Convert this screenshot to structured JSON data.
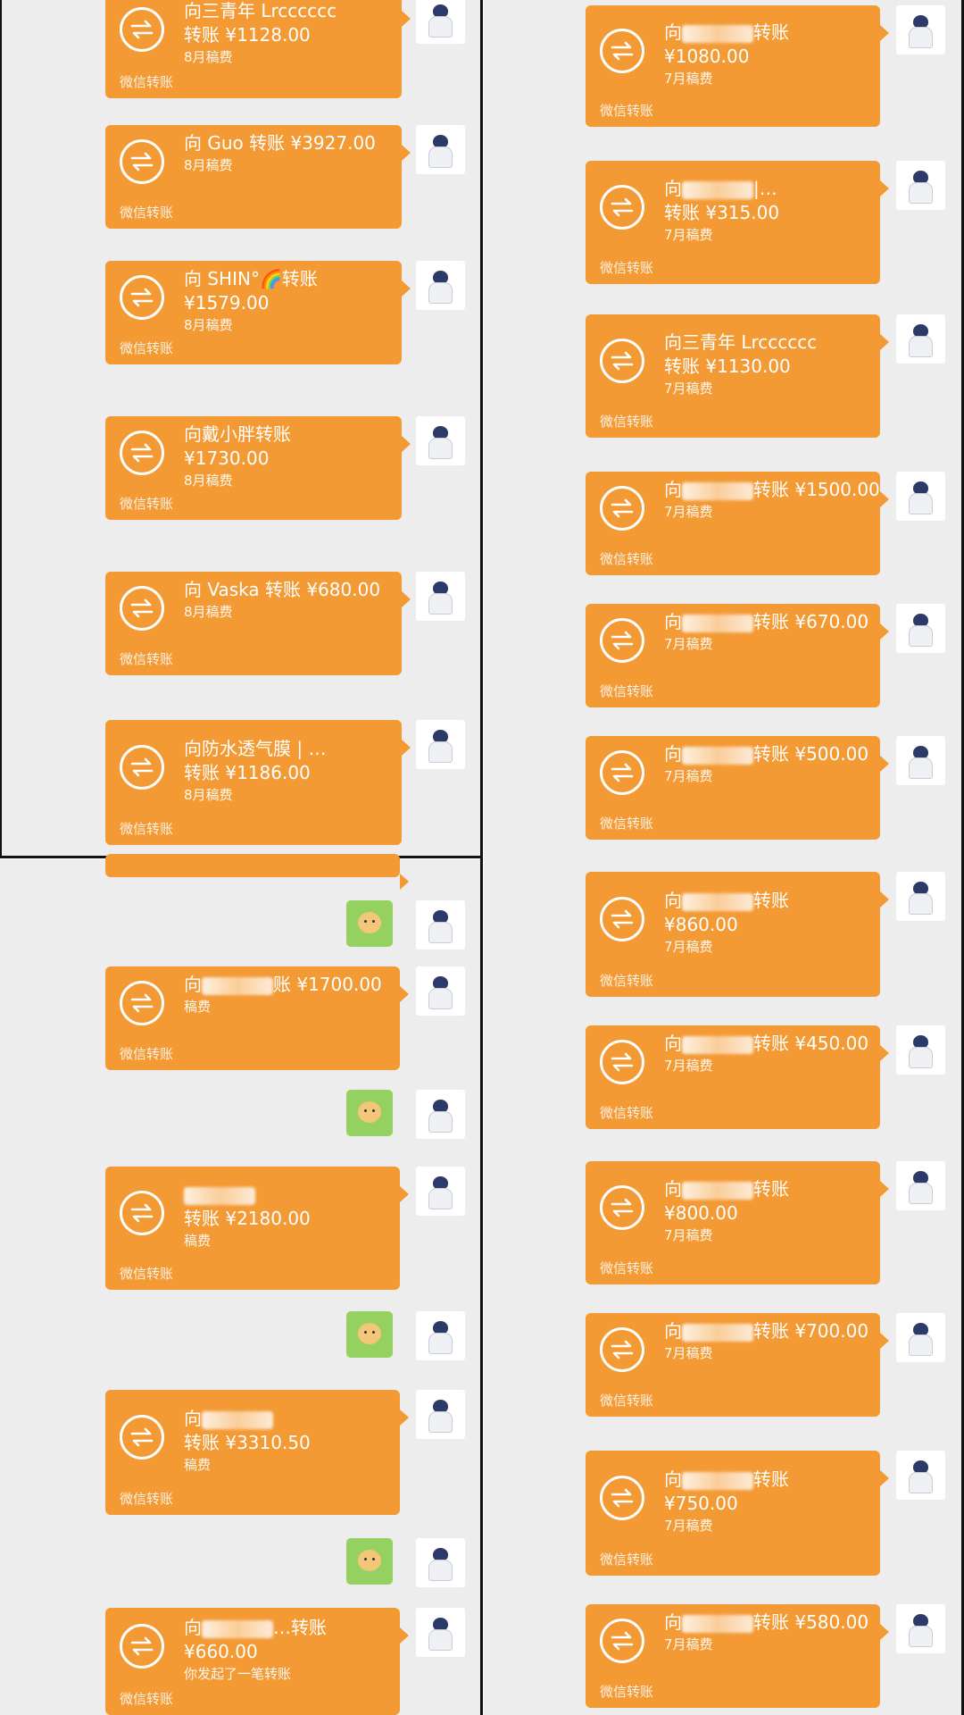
{
  "footer_label": "微信转账",
  "left_top": [
    {
      "line1": "向三青年 Lrcccccc",
      "line2": "转账 ¥1128.00",
      "note": "8月稿费"
    },
    {
      "line1": "向 Guo 转账 ¥3927.00",
      "line2": "",
      "note": "8月稿费"
    },
    {
      "line1": "向 SHIN°🌈转账",
      "line2": "¥1579.00",
      "note": "8月稿费"
    },
    {
      "line1": "向戴小胖转账",
      "line2": "¥1730.00",
      "note": "8月稿费"
    },
    {
      "line1": "向 Vaska 转账 ¥680.00",
      "line2": "",
      "note": "8月稿费"
    },
    {
      "line1": "向防水透气膜 | …",
      "line2": "转账 ¥1186.00",
      "note": "8月稿费"
    }
  ],
  "left_bottom": [
    {
      "line1": "向",
      "blur": true,
      "line1b": "账 ¥1700.00",
      "line2": "",
      "note": "稿费"
    },
    {
      "line1": "",
      "blur": true,
      "line2": "转账 ¥2180.00",
      "note": "稿费"
    },
    {
      "line1": "向",
      "blur": true,
      "line2": "转账 ¥3310.50",
      "note": "稿费"
    },
    {
      "line1": "向",
      "blur": true,
      "line1b": "…转账",
      "line2": "¥660.00",
      "note": "你发起了一笔转账"
    }
  ],
  "right": [
    {
      "line1": "向",
      "blur": true,
      "line1b": "转账",
      "line2": "¥1080.00",
      "note": "7月稿费"
    },
    {
      "line1": "向",
      "blur": true,
      "line1b": "|…",
      "line2": "转账 ¥315.00",
      "note": "7月稿费"
    },
    {
      "line1": "向三青年 Lrcccccc",
      "line2": "转账 ¥1130.00",
      "note": "7月稿费"
    },
    {
      "line1": "向",
      "blur": true,
      "line1b": "转账 ¥1500.00",
      "line2": "",
      "note": "7月稿费"
    },
    {
      "line1": "向",
      "blur": true,
      "line1b": "转账 ¥670.00",
      "line2": "",
      "note": "7月稿费"
    },
    {
      "line1": "向",
      "blur": true,
      "line1b": "转账 ¥500.00",
      "line2": "",
      "note": "7月稿费"
    },
    {
      "line1": "向",
      "blur": true,
      "line1b": "转账",
      "line2": "¥860.00",
      "note": "7月稿费"
    },
    {
      "line1": "向",
      "blur": true,
      "line1b": "转账 ¥450.00",
      "line2": "",
      "note": "7月稿费"
    },
    {
      "line1": "向",
      "blur": true,
      "line1b": "转账",
      "line2": "¥800.00",
      "note": "7月稿费"
    },
    {
      "line1": "向",
      "blur": true,
      "line1b": "转账 ¥700.00",
      "line2": "",
      "note": "7月稿费"
    },
    {
      "line1": "向",
      "blur": true,
      "line1b": "转账",
      "line2": "¥750.00",
      "note": "7月稿费"
    },
    {
      "line1": "向",
      "blur": true,
      "line1b": "转账 ¥580.00",
      "line2": "",
      "note": "7月稿费"
    }
  ]
}
